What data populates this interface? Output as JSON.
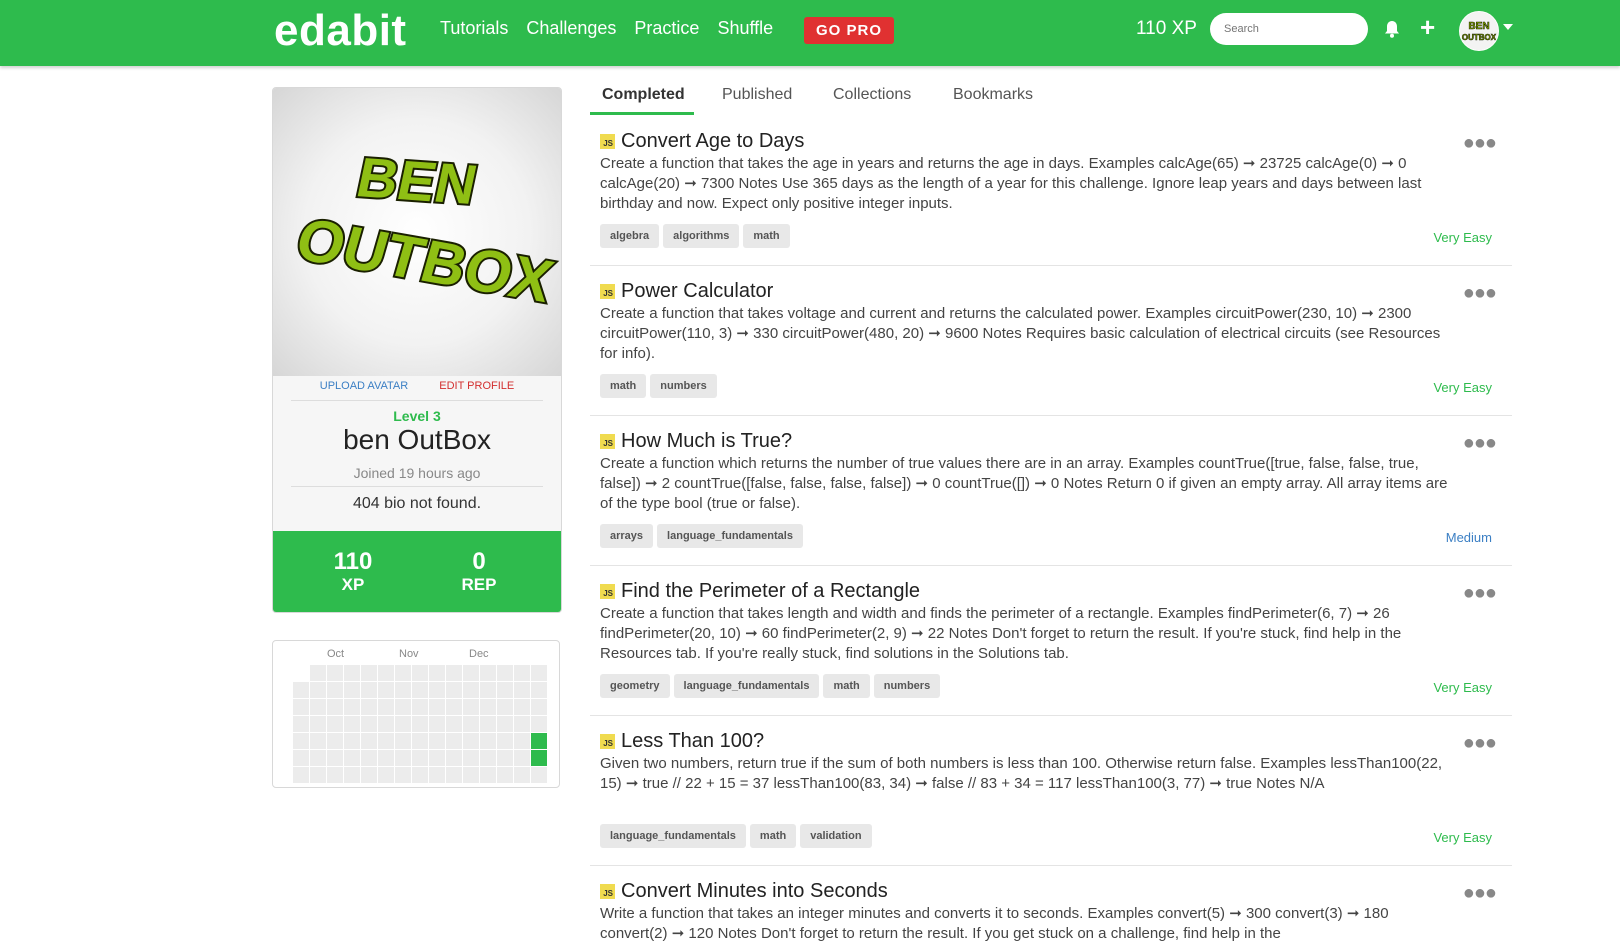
{
  "navbar": {
    "brand": "edabit",
    "links": [
      "Tutorials",
      "Challenges",
      "Practice",
      "Shuffle"
    ],
    "gopro": "GO PRO",
    "xp": "110 XP",
    "search_placeholder": "Search",
    "plus": "+"
  },
  "profile": {
    "avatar_text_line1": "BEN",
    "avatar_text_line2": "OUTBOX",
    "upload_avatar": "UPLOAD AVATAR",
    "edit_profile": "EDIT PROFILE",
    "level": "Level 3",
    "username": "ben OutBox",
    "joined": "Joined 19 hours ago",
    "bio": "404 bio not found.",
    "stats": [
      {
        "value": "110",
        "label": "XP"
      },
      {
        "value": "0",
        "label": "REP"
      }
    ]
  },
  "heatmap": {
    "months": [
      "Oct",
      "Nov",
      "Dec"
    ]
  },
  "tabs": [
    "Completed",
    "Published",
    "Collections",
    "Bookmarks"
  ],
  "active_tab": "Completed",
  "challenges": [
    {
      "lang": "JS",
      "title": "Convert Age to Days",
      "description": "Create a function that takes the age in years and returns the age in days. Examples calcAge(65) ➞ 23725 calcAge(0) ➞ 0 calcAge(20) ➞ 7300 Notes Use 365 days as the length of a year for this challenge. Ignore leap years and days between last birthday and now. Expect only positive integer inputs.",
      "tags": [
        "algebra",
        "algorithms",
        "math"
      ],
      "difficulty": "Very Easy"
    },
    {
      "lang": "JS",
      "title": "Power Calculator",
      "description": "Create a function that takes voltage and current and returns the calculated power. Examples circuitPower(230, 10) ➞ 2300 circuitPower(110, 3) ➞ 330 circuitPower(480, 20) ➞ 9600 Notes Requires basic calculation of electrical circuits (see Resources for info).",
      "tags": [
        "math",
        "numbers"
      ],
      "difficulty": "Very Easy"
    },
    {
      "lang": "JS",
      "title": "How Much is True?",
      "description": "Create a function which returns the number of true values there are in an array. Examples countTrue([true, false, false, true, false]) ➞ 2 countTrue([false, false, false, false]) ➞ 0 countTrue([]) ➞ 0 Notes Return 0 if given an empty array. All array items are of the type bool (true or false).",
      "tags": [
        "arrays",
        "language_fundamentals"
      ],
      "difficulty": "Medium"
    },
    {
      "lang": "JS",
      "title": "Find the Perimeter of a Rectangle",
      "description": "Create a function that takes length and width and finds the perimeter of a rectangle. Examples findPerimeter(6, 7) ➞ 26 findPerimeter(20, 10) ➞ 60 findPerimeter(2, 9) ➞ 22 Notes Don't forget to return the result. If you're stuck, find help in the Resources tab. If you're really stuck, find solutions in the Solutions tab.",
      "tags": [
        "geometry",
        "language_fundamentals",
        "math",
        "numbers"
      ],
      "difficulty": "Very Easy"
    },
    {
      "lang": "JS",
      "title": "Less Than 100?",
      "description": "Given two numbers, return true if the sum of both numbers is less than 100. Otherwise return false. Examples lessThan100(22, 15) ➞ true // 22 + 15 = 37 lessThan100(83, 34) ➞ false // 83 + 34 = 117 lessThan100(3, 77) ➞ true Notes N/A",
      "tags": [
        "language_fundamentals",
        "math",
        "validation"
      ],
      "difficulty": "Very Easy"
    },
    {
      "lang": "JS",
      "title": "Convert Minutes into Seconds",
      "description": "Write a function that takes an integer minutes and converts it to seconds. Examples convert(5) ➞ 300 convert(3) ➞ 180 convert(2) ➞ 120 Notes Don't forget to return the result. If you get stuck on a challenge, find help in the",
      "tags": [],
      "difficulty": ""
    }
  ],
  "colors": {
    "brand_green": "#2ebb4d",
    "gopro_red": "#e03131",
    "difficulty_very_easy": "#2ebb4d",
    "difficulty_medium": "#3b7fc4"
  }
}
